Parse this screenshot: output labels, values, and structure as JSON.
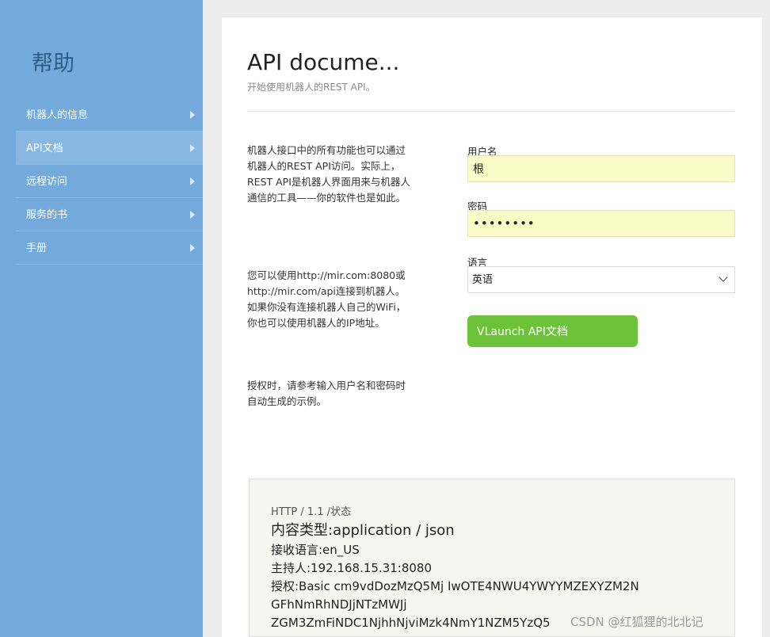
{
  "sidebar": {
    "title": "帮助",
    "items": [
      {
        "label": "机器人的信息",
        "active": false
      },
      {
        "label": "API文档",
        "active": true
      },
      {
        "label": "远程访问",
        "active": false
      },
      {
        "label": "服务的书",
        "active": false
      },
      {
        "label": "手册",
        "active": false
      }
    ]
  },
  "main": {
    "title": "API docume...",
    "subtitle": "开始使用机器人的REST API。",
    "desc1": [
      "机器人接口中的所有功能也可以通过",
      "机器人的REST API访问。实际上，",
      "REST API是机器人界面用来与机器人",
      "通信的工具——你的软件也是如此。"
    ],
    "desc2": [
      "您可以使用http://mir.com:8080或",
      "http://mir.com/api连接到机器人。",
      "如果你没有连接机器人自己的WiFi，",
      "你也可以使用机器人的IP地址。"
    ],
    "desc3": [
      "授权时，请参考输入用户名和密码时",
      "自动生成的示例。"
    ]
  },
  "form": {
    "username_label": "用户名",
    "username_value": "根",
    "password_label": "密码",
    "password_value": "••••••••",
    "language_label": "语言",
    "language_value": "英语",
    "launch_label": "VLaunch API文档"
  },
  "code": {
    "line1": "HTTP / 1.1 /状态",
    "line2": "内容类型:application / json",
    "line3": "接收语言:en_US",
    "line4": "主持人:192.168.15.31:8080",
    "line5": "授权:Basic cm9vdDozMzQ5Mj IwOTE4NWU4YWYYMZEXYZM2N",
    "line6": "GFhNmRhNDJjNTzMWJj",
    "line7": "ZGM3ZmFiNDC1NjhhNjviMzk4NmY1NZM5YzQ5"
  },
  "watermark": "CSDN @红狐狸的北北记",
  "colors": {
    "sidebar": "#74a9db",
    "launch_button": "#6cc339",
    "input_bg": "#fafcc8"
  }
}
